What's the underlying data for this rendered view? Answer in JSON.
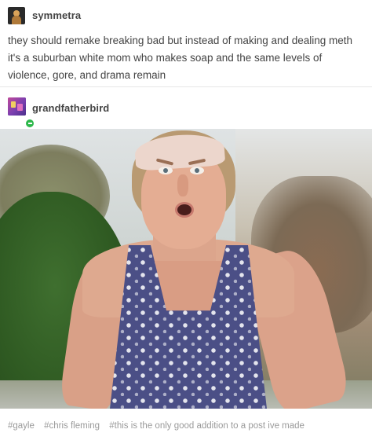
{
  "original_post": {
    "username": "symmetra",
    "text": "they should remake breaking bad but instead of making and dealing meth it's a suburban white mom who makes soap and the same levels of violence, gore, and drama remain"
  },
  "reblog": {
    "username": "grandfatherbird",
    "tags": [
      "#gayle",
      "#chris fleming",
      "#this is the only good addition to a post ive made"
    ]
  },
  "colors": {
    "text": "#444444",
    "tag_text": "#9a9a9a",
    "follow_badge": "#2db84b",
    "divider": "#e6e6e6"
  },
  "icons": {
    "op_avatar": "avatar-icon",
    "reblog_avatar": "avatar-icon",
    "follow_badge": "follow-plus-icon"
  }
}
